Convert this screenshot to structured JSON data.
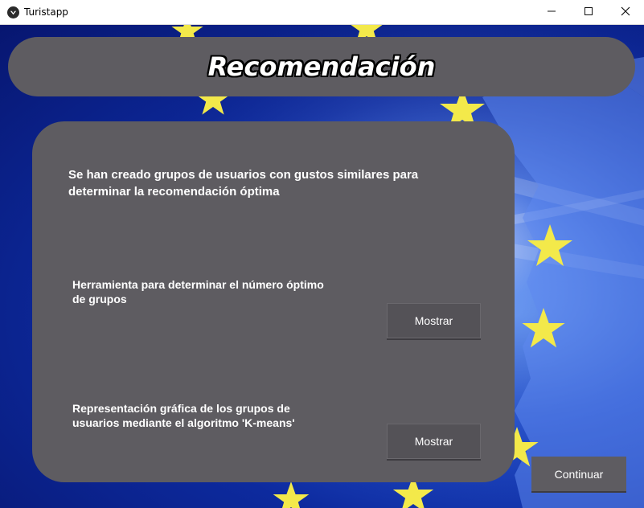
{
  "window": {
    "title": "Turistapp",
    "controls": [
      "minimize",
      "maximize",
      "close"
    ]
  },
  "header": {
    "title": "Recomendación"
  },
  "panel": {
    "intro_text": "Se han creado grupos de usuarios con gustos similares para determinar la recomendación óptima",
    "rows": [
      {
        "label": "Herramienta para determinar el número óptimo de grupos",
        "button": "Mostrar"
      },
      {
        "label": "Representación gráfica de los grupos de usuarios mediante el algoritmo 'K-means'",
        "button": "Mostrar"
      }
    ]
  },
  "footer": {
    "continue_label": "Continuar"
  },
  "colors": {
    "panel": "#5e5c61",
    "background_blue": "#0d2a9e",
    "star_yellow": "#f3e94a"
  },
  "icons": {
    "app": "app-logo-icon",
    "minimize": "minimize-icon",
    "maximize": "maximize-icon",
    "close": "close-icon",
    "background": "eu-flag-map-background"
  }
}
